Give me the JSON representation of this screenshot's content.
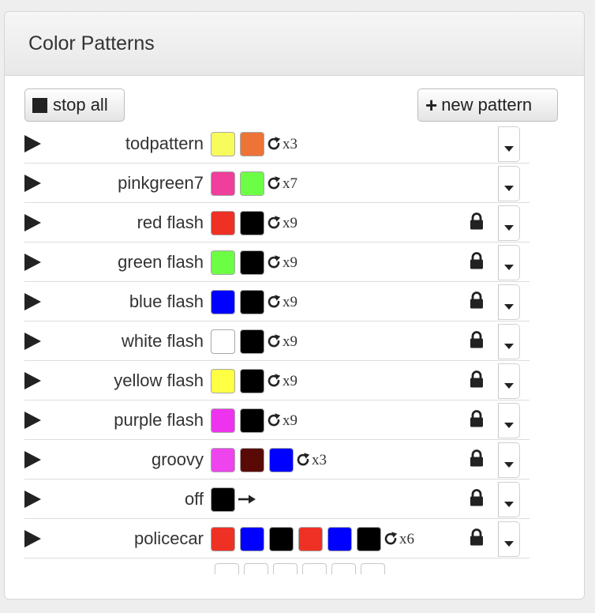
{
  "panel": {
    "title": "Color Patterns"
  },
  "toolbar": {
    "stop_all_label": "stop all",
    "new_pattern_label": "new pattern"
  },
  "patterns": [
    {
      "name": "todpattern",
      "colors": [
        "#f8fb5c",
        "#ee7336"
      ],
      "repeat": "x3",
      "locked": false
    },
    {
      "name": "pinkgreen7",
      "colors": [
        "#ef3e9b",
        "#6cfd45"
      ],
      "repeat": "x7",
      "locked": false
    },
    {
      "name": "red flash",
      "colors": [
        "#ee3124",
        "#000000"
      ],
      "repeat": "x9",
      "locked": true
    },
    {
      "name": "green flash",
      "colors": [
        "#6cfd45",
        "#000000"
      ],
      "repeat": "x9",
      "locked": true
    },
    {
      "name": "blue flash",
      "colors": [
        "#0000ff",
        "#000000"
      ],
      "repeat": "x9",
      "locked": true
    },
    {
      "name": "white flash",
      "colors": [
        "#ffffff",
        "#000000"
      ],
      "repeat": "x9",
      "locked": true
    },
    {
      "name": "yellow flash",
      "colors": [
        "#ffff44",
        "#000000"
      ],
      "repeat": "x9",
      "locked": true
    },
    {
      "name": "purple flash",
      "colors": [
        "#ee33ee",
        "#000000"
      ],
      "repeat": "x9",
      "locked": true
    },
    {
      "name": "groovy",
      "colors": [
        "#ee44ee",
        "#5a0a06",
        "#0000ff"
      ],
      "repeat": "x3",
      "locked": true
    },
    {
      "name": "off",
      "colors": [
        "#000000"
      ],
      "repeat": "",
      "locked": true,
      "no_repeat_arrow": true
    },
    {
      "name": "policecar",
      "colors": [
        "#ee3124",
        "#0000ff",
        "#000000",
        "#ee3124",
        "#0000ff",
        "#000000"
      ],
      "repeat": "x6",
      "locked": true
    }
  ],
  "icons": {
    "play": "play-icon",
    "repeat": "repeat-icon",
    "lock": "lock-icon",
    "caret": "caret-down-icon",
    "stop": "stop-icon",
    "plus": "plus-icon",
    "arrow": "arrow-right-icon"
  }
}
